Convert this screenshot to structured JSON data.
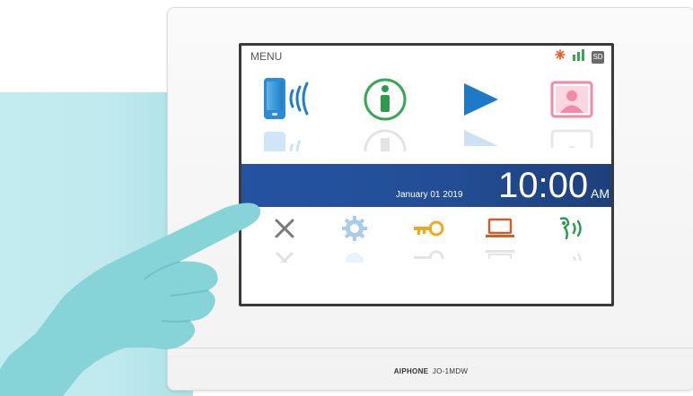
{
  "screen": {
    "menu_label": "MENU",
    "icons_top": [
      "phone-wireless-icon",
      "info-icon",
      "play-icon",
      "photo-icon"
    ],
    "icons_bottom": [
      "close-icon",
      "settings-gear-icon",
      "key-icon",
      "laptop-icon",
      "speaker-icon"
    ],
    "status_icons": [
      "no-broadcast-icon",
      "signal-bars-icon",
      "sd-card-icon"
    ],
    "sd_label": "SD",
    "date": "January 01 2019",
    "time": "10:00",
    "ampm": "AM"
  },
  "device": {
    "brand": "AIPHONE",
    "model": "JO-1MDW"
  },
  "colors": {
    "bar_blue": "#2453a1",
    "accent_teal": "#a9e1e6",
    "info_green": "#3aa655",
    "play_blue": "#1d7ac9",
    "key_orange": "#f0a81e",
    "photo_pink": "#f28aa7",
    "signal_green": "#3aa655",
    "broadcast_orange": "#f05a24"
  }
}
